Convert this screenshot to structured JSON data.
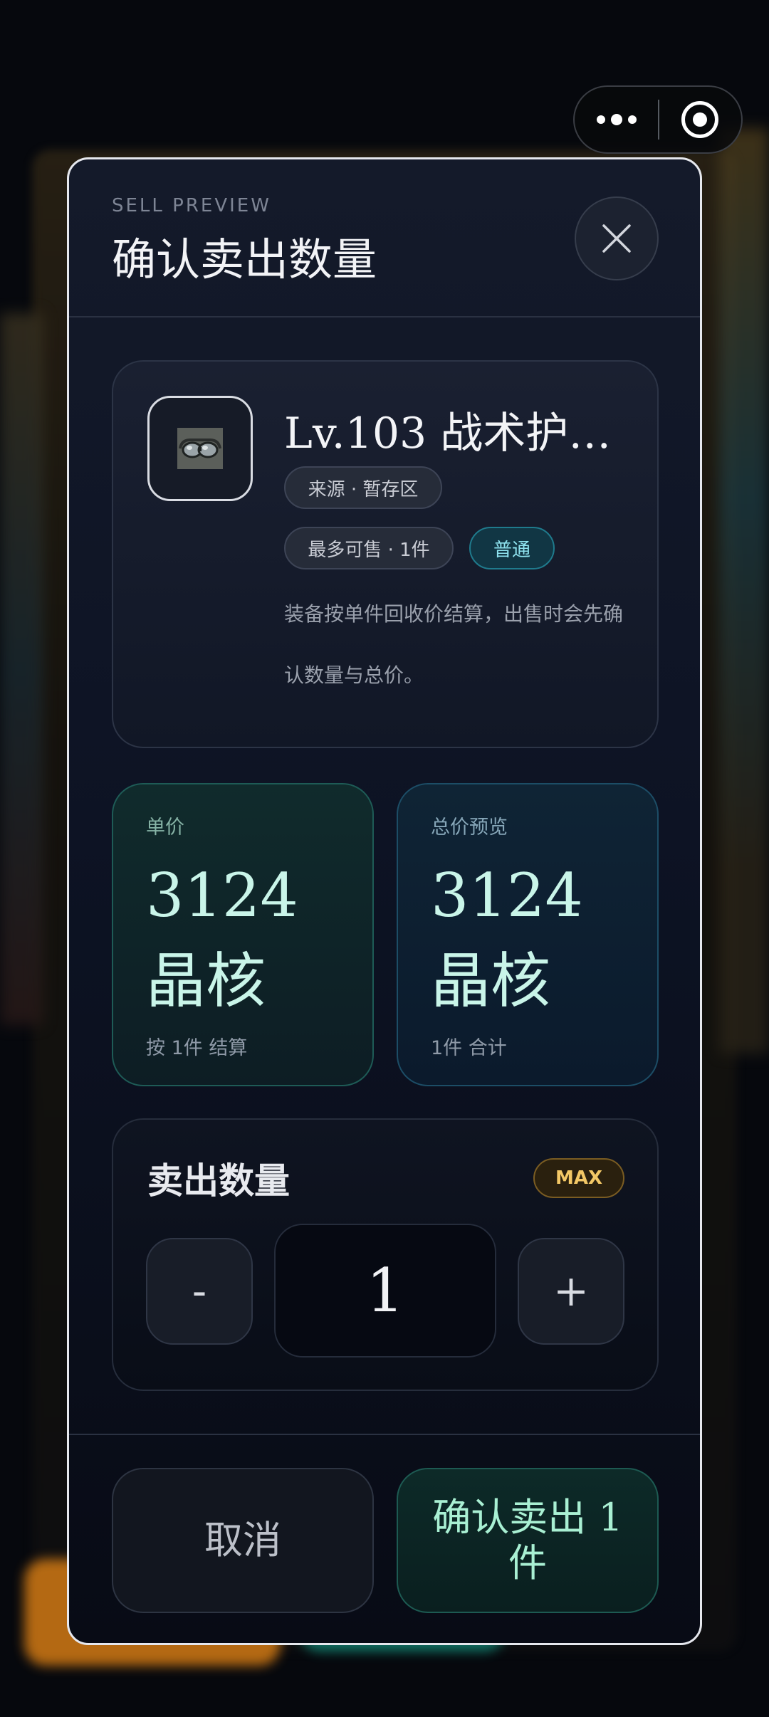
{
  "header": {
    "eyebrow": "SELL PREVIEW",
    "title": "确认卖出数量",
    "close_icon": "close-icon"
  },
  "item": {
    "icon": "goggles-icon",
    "name": "Lv.103 战术护…",
    "source_chip": "来源 · 暂存区",
    "max_chip": "最多可售 · 1件",
    "rarity_chip": "普通",
    "description": "装备按单件回收价结算，出售时会先确认数量与总价。"
  },
  "unit_price": {
    "label": "单价",
    "value": "3124 晶核",
    "sub": "按 1件 结算"
  },
  "total_price": {
    "label": "总价预览",
    "value": "3124 晶核",
    "sub": "1件 合计"
  },
  "quantity": {
    "title": "卖出数量",
    "max_label": "MAX",
    "minus_label": "-",
    "value": "1",
    "plus_label": "+"
  },
  "footer": {
    "cancel_label": "取消",
    "confirm_label": "确认卖出 1 件"
  },
  "colors": {
    "accent_teal": "#a9f0d3",
    "accent_gold": "#f3c866",
    "rarity_teal": "#8fe3ef"
  }
}
